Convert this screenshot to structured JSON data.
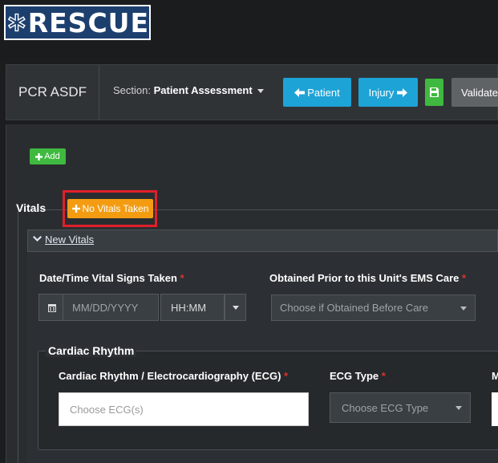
{
  "app": {
    "logo_text": "RESCUE"
  },
  "toolbar": {
    "pcr_label": "PCR ASDF",
    "section_prefix": "Section: ",
    "section_value": "Patient Assessment",
    "patient_button": "Patient",
    "injury_button": "Injury",
    "validate_button": "Validate"
  },
  "panel": {
    "add_button": "Add",
    "vitals_label": "Vitals",
    "no_vitals_button": "No Vitals Taken",
    "new_vitals_link": "New Vitals"
  },
  "form": {
    "datetime_label": "Date/Time Vital Signs Taken",
    "date_placeholder": "MM/DD/YYYY",
    "time_value": "HH:MM",
    "obtained_label": "Obtained Prior to this Unit's EMS Care",
    "obtained_placeholder": "Choose if Obtained Before Care",
    "cardiac_title": "Cardiac Rhythm",
    "ecg_label": "Cardiac Rhythm / Electrocardiography (ECG)",
    "ecg_placeholder": "Choose ECG(s)",
    "ecg_type_label": "ECG Type",
    "ecg_type_placeholder": "Choose ECG Type",
    "cut_label": "M",
    "required_mark": "*"
  },
  "colors": {
    "accent_blue": "#1ea3d6",
    "success_green": "#3fb93f",
    "warning_orange": "#f39c12",
    "highlight_red": "#e0202a"
  },
  "icons": [
    "star-of-life-icon",
    "arrow-left-icon",
    "arrow-right-icon",
    "save-icon",
    "plus-icon",
    "chevron-down-icon",
    "calendar-icon",
    "caret-down-icon"
  ]
}
